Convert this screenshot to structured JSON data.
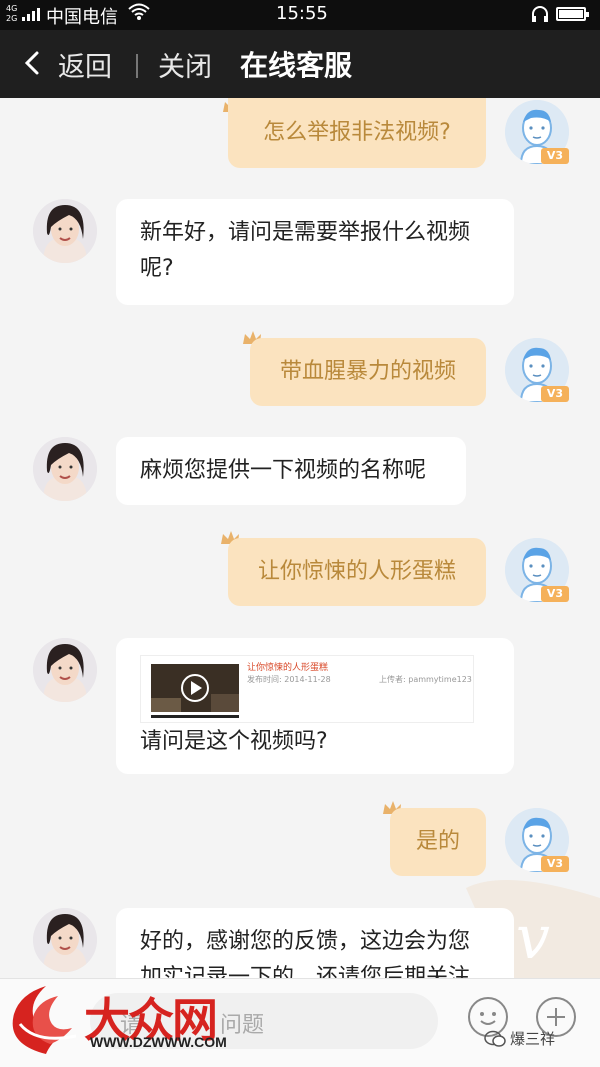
{
  "status_bar": {
    "network_badge": "4G\n2G",
    "carrier": "中国电信",
    "time": "15:55"
  },
  "nav": {
    "back_label": "返回",
    "close_label": "关闭",
    "title": "在线客服"
  },
  "messages": [
    {
      "from": "user",
      "text": "怎么举报非法视频?"
    },
    {
      "from": "agent",
      "text": "新年好，请问是需要举报什么视频呢?"
    },
    {
      "from": "user",
      "text": "带血腥暴力的视频"
    },
    {
      "from": "agent",
      "text": "麻烦您提供一下视频的名称呢"
    },
    {
      "from": "user",
      "text": "让你惊悚的人形蛋糕"
    },
    {
      "from": "agent",
      "text": "请问是这个视频吗?"
    },
    {
      "from": "user",
      "text": "是的"
    },
    {
      "from": "agent",
      "text": "好的，感谢您的反馈，这边会为您加实记录一下的，还请您后期关注"
    }
  ],
  "video_card": {
    "title": "让你惊悚的人形蛋糕",
    "date": "发布时间: 2014-11-28",
    "uploader": "上传者: pammytime123"
  },
  "user_badge": "V3",
  "input": {
    "placeholder_pre": "请",
    "placeholder_post": "问题"
  },
  "logo": {
    "brand": "大众网",
    "site": "WWW.DZWWW.COM"
  },
  "watermark": "爆三祥",
  "colors": {
    "nav_bg": "#1f1f1f",
    "user_bubble": "#fbe3bf",
    "user_text": "#b9893b",
    "agent_bubble": "#ffffff",
    "accent": "#f5b15a",
    "logo_red": "#d6231f"
  }
}
